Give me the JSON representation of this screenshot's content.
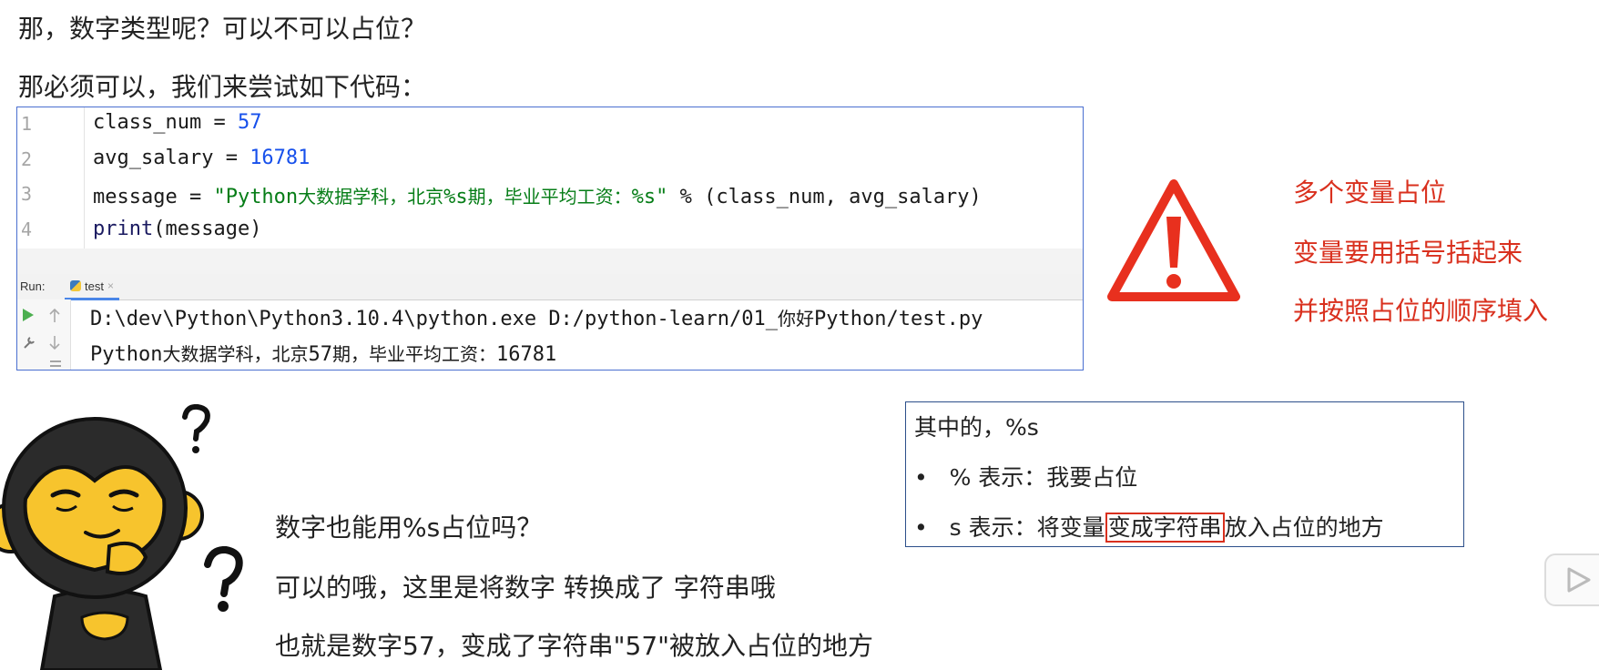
{
  "headings": {
    "question": "那，数字类型呢？可以不可以占位？",
    "intro": "那必须可以，我们来尝试如下代码："
  },
  "editor": {
    "line_numbers": [
      "1",
      "2",
      "3",
      "4"
    ],
    "line1": {
      "var": "class_num = ",
      "num": "57"
    },
    "line2": {
      "var": "avg_salary = ",
      "num": "16781"
    },
    "line3": {
      "var": "message = ",
      "str_open": "\"Python",
      "str_cn1": "大数据学科，北京",
      "str_fmt1": "%s",
      "str_cn2": "期，毕业平均工资：",
      "str_close": "%s\"",
      "rest": " % (class_num, avg_salary)"
    },
    "line4": {
      "fn": "print",
      "rest": "(message)"
    }
  },
  "run_panel": {
    "label": "Run:",
    "tab": "test",
    "tab_close": "×",
    "output1_a": "D:\\dev\\Python\\Python3.10.4\\python.exe D:/python-learn/01_",
    "output1_cn": "你好",
    "output1_b": "Python/test.py",
    "output2_a": "Python",
    "output2_cn1": "大数据学科，北京",
    "output2_num": "57",
    "output2_cn2": "期，毕业平均工资：",
    "output2_num2": "16781"
  },
  "warning_notes": [
    "多个变量占位",
    "变量要用括号括起来",
    "并按照占位的顺序填入"
  ],
  "info_box": {
    "title": "其中的，%s",
    "item1": "%  表示：我要占位",
    "item2_a": "s  表示：将变量",
    "item2_highlight": "变成字符串",
    "item2_b": "放入占位的地方",
    "bullet": "•"
  },
  "body": {
    "question": "数字也能用%s占位吗？",
    "answer1": "可以的哦，这里是将数字 转换成了 字符串哦",
    "answer2": "也就是数字57，变成了字符串\"57\"被放入占位的地方"
  },
  "colors": {
    "accent_red": "#d9301e",
    "string_green": "#067d17",
    "number_blue": "#1750eb",
    "box_border": "#2c4f8a"
  },
  "icons": [
    "warning-icon",
    "monkey-mascot",
    "question-mark-icon",
    "play-icon",
    "python-icon"
  ]
}
